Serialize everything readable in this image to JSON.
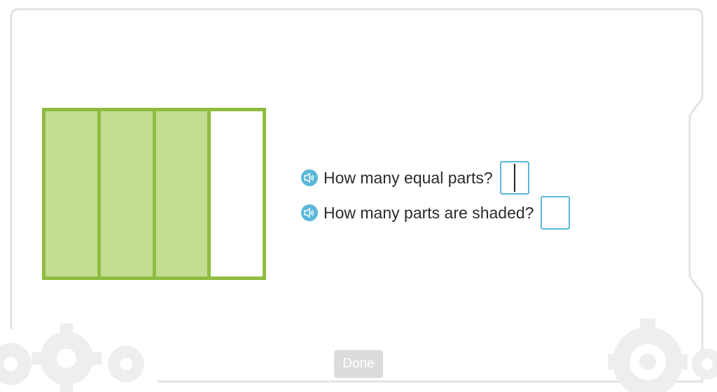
{
  "figure": {
    "total_parts": 4,
    "shaded_parts": 3,
    "colors": {
      "border": "#8fbc3f",
      "shaded": "#c3dd92",
      "unshaded": "#ffffff"
    }
  },
  "questions": [
    {
      "text": "How many equal parts?",
      "answer_value": "",
      "icon": "speaker-icon"
    },
    {
      "text": "How many parts are shaded?",
      "answer_value": "",
      "icon": "speaker-icon"
    }
  ],
  "done_label": "Done",
  "colors": {
    "accent": "#5bb7d9",
    "frame": "#e6e6e6"
  }
}
